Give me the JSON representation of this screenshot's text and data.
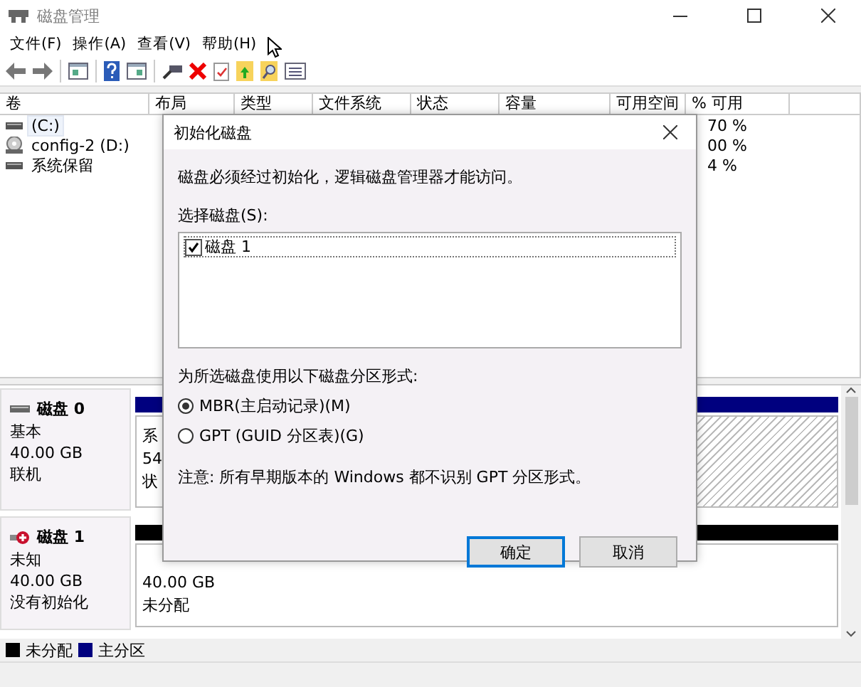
{
  "window": {
    "title": "磁盘管理"
  },
  "menu": [
    {
      "label": "文件(F)"
    },
    {
      "label": "操作(A)"
    },
    {
      "label": "查看(V)"
    },
    {
      "label": "帮助(H)"
    }
  ],
  "volume_table": {
    "columns": [
      "卷",
      "布局",
      "类型",
      "文件系统",
      "状态",
      "容量",
      "可用空间",
      "% 可用"
    ],
    "rows": [
      {
        "volume": "(C:)",
        "kind": "disk",
        "selected": true,
        "percent_free": "70 %"
      },
      {
        "volume": "config-2 (D:)",
        "kind": "cdrom",
        "selected": false,
        "percent_free": "00 %"
      },
      {
        "volume": "系统保留",
        "kind": "disk",
        "selected": false,
        "percent_free": "4 %"
      }
    ]
  },
  "disks": [
    {
      "name": "磁盘 0",
      "kind": "basic",
      "type": "基本",
      "size": "40.00 GB",
      "status": "联机",
      "partitions": [
        {
          "kind": "primary",
          "lines": [
            "系",
            "54",
            "状"
          ],
          "selected": false
        },
        {
          "kind": "primary",
          "selected": true
        }
      ]
    },
    {
      "name": "磁盘 1",
      "kind": "uninitialized",
      "type": "未知",
      "size": "40.00 GB",
      "status": "没有初始化",
      "partitions": [
        {
          "kind": "unallocated",
          "lines": [
            "40.00 GB",
            "未分配"
          ],
          "selected": false
        }
      ]
    }
  ],
  "legend": [
    {
      "label": "未分配",
      "color": "#000000"
    },
    {
      "label": "主分区",
      "color": "#00007f"
    }
  ],
  "dialog": {
    "title": "初始化磁盘",
    "message": "磁盘必须经过初始化，逻辑磁盘管理器才能访问。",
    "disk_list_label": "选择磁盘(S):",
    "disk_list": [
      {
        "label": "磁盘 1",
        "checked": true
      }
    ],
    "style_label": "为所选磁盘使用以下磁盘分区形式:",
    "options": [
      {
        "label": "MBR(主启动记录)(M)",
        "selected": true
      },
      {
        "label": "GPT (GUID 分区表)(G)",
        "selected": false
      }
    ],
    "note": "注意: 所有早期版本的 Windows 都不识别 GPT 分区形式。",
    "buttons": [
      {
        "label": "确定",
        "kind": "default"
      },
      {
        "label": "取消",
        "kind": "normal"
      }
    ]
  }
}
